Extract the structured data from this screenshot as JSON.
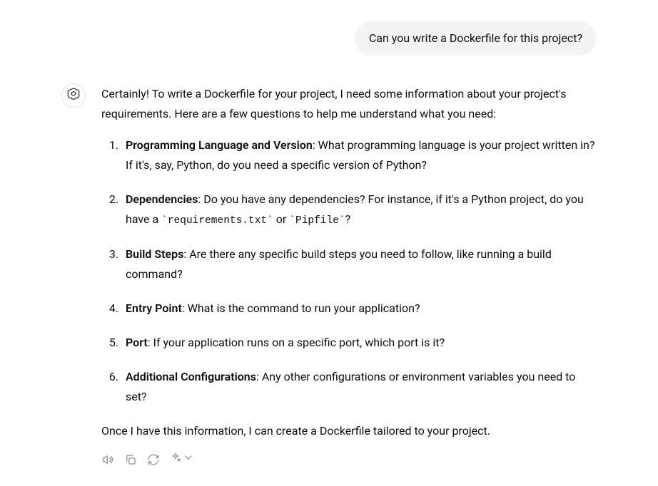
{
  "user_message": {
    "text": "Can you write a  Dockerfile for this project?"
  },
  "assistant": {
    "intro": "Certainly! To write a Dockerfile for your project, I need some information about your project's requirements. Here are a few questions to help me understand what you need:",
    "questions": [
      {
        "title": "Programming Language and Version",
        "body": ": What programming language is your project written in? If it's, say, Python, do you need a specific version of Python?"
      },
      {
        "title": "Dependencies",
        "body_prefix": ": Do you have any dependencies? For instance, if it's a Python project, do you have a ",
        "code1": "requirements.txt",
        "mid": " or ",
        "code2": "Pipfile",
        "body_suffix": "?"
      },
      {
        "title": "Build Steps",
        "body": ": Are there any specific build steps you need to follow, like running a build command?"
      },
      {
        "title": "Entry Point",
        "body": ": What is the command to run your application?"
      },
      {
        "title": "Port",
        "body": ": If your application runs on a specific port, which port is it?"
      },
      {
        "title": "Additional Configurations",
        "body": ": Any other configurations or environment variables you need to set?"
      }
    ],
    "outro": "Once I have this information, I can create a Dockerfile tailored to your project."
  },
  "actions": {
    "read_aloud": "Read aloud",
    "copy": "Copy",
    "regenerate": "Regenerate",
    "model": "Change model"
  }
}
